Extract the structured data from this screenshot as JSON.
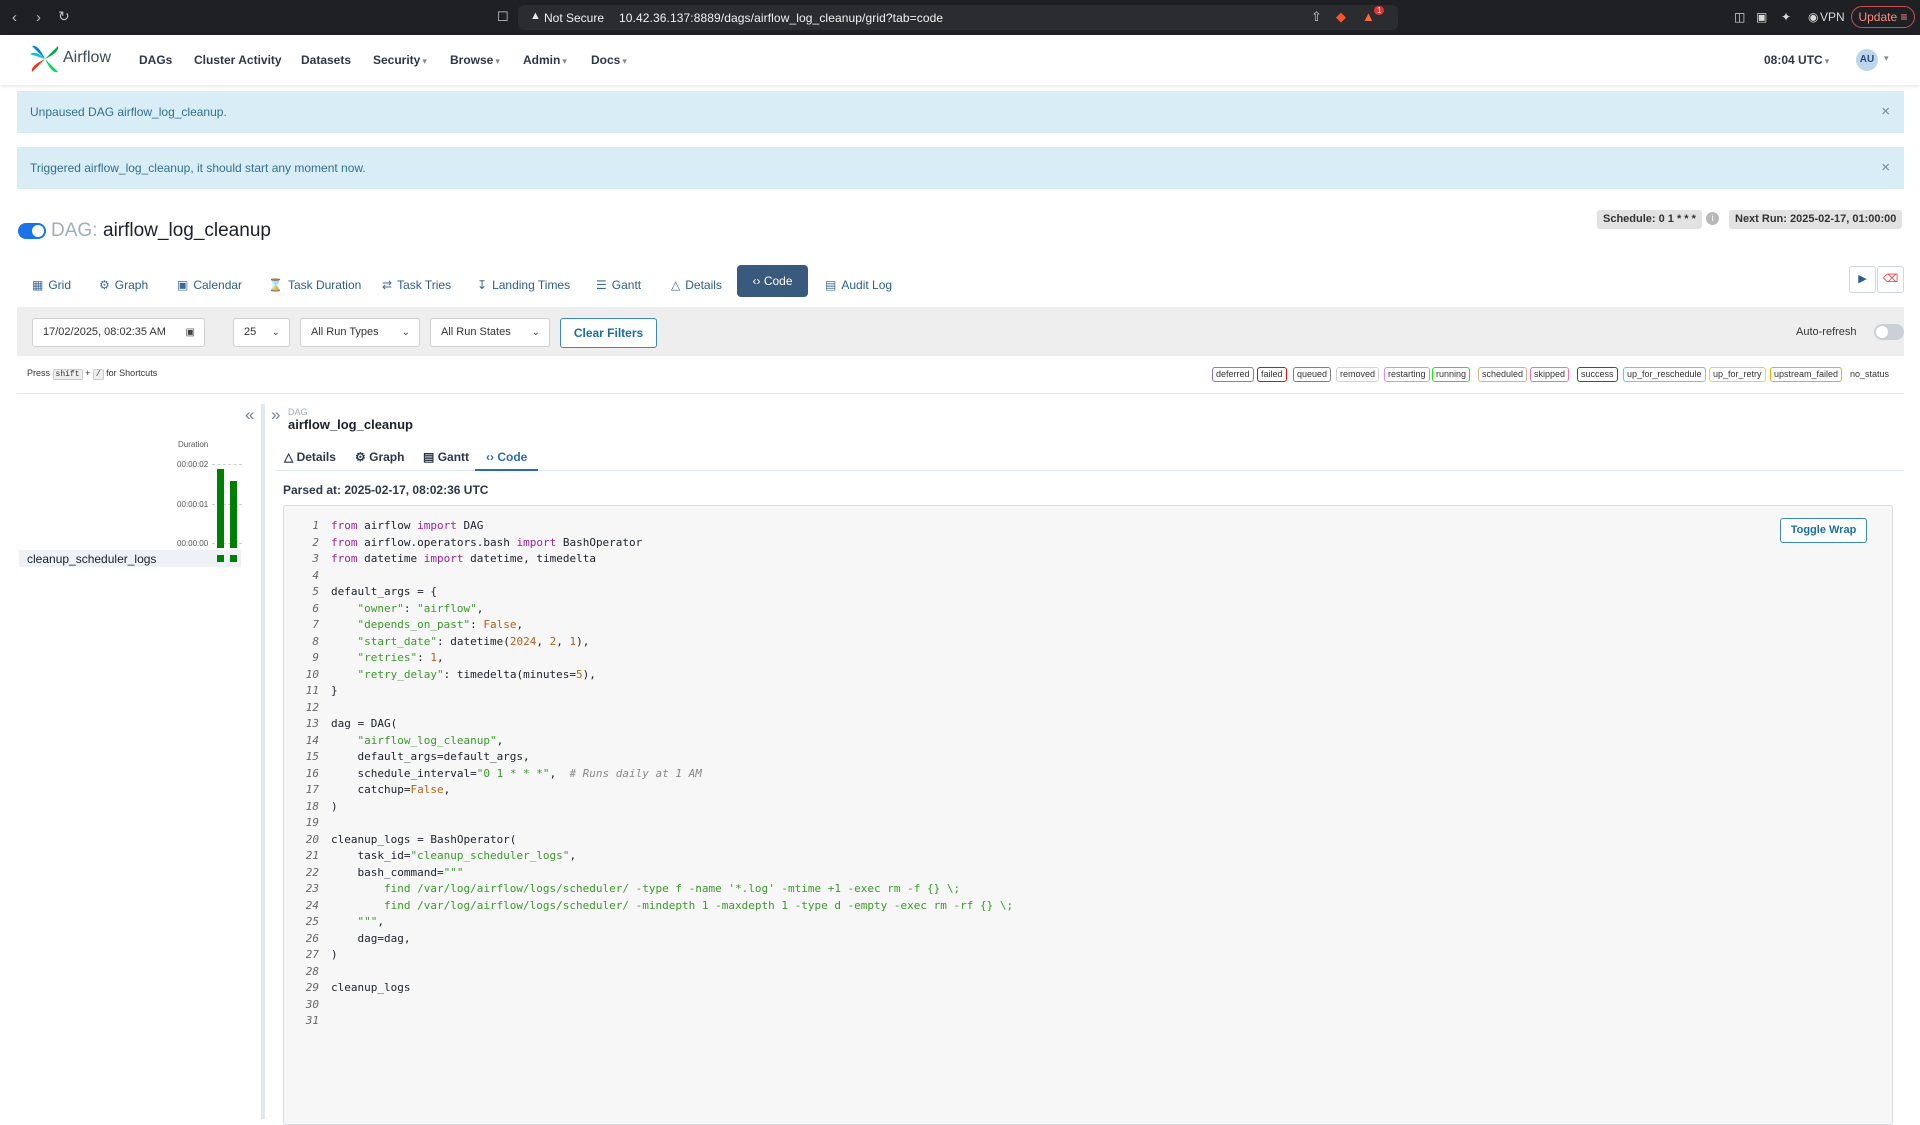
{
  "browser": {
    "security_label": "Not Secure",
    "url": "10.42.36.137:8889/dags/airflow_log_cleanup/grid?tab=code",
    "vpn_label": "VPN",
    "update_label": "Update",
    "brave_badge": "1"
  },
  "header": {
    "brand": "Airflow",
    "nav": [
      {
        "label": "DAGs"
      },
      {
        "label": "Cluster Activity"
      },
      {
        "label": "Datasets"
      },
      {
        "label": "Security"
      },
      {
        "label": "Browse"
      },
      {
        "label": "Admin"
      },
      {
        "label": "Docs"
      }
    ],
    "clock": "08:04 UTC",
    "avatar": "AU"
  },
  "alerts": [
    "Unpaused DAG airflow_log_cleanup.",
    "Triggered airflow_log_cleanup, it should start any moment now."
  ],
  "dag": {
    "prefix": "DAG:",
    "title": "airflow_log_cleanup",
    "schedule": "Schedule: 0 1 * * *",
    "next_run": "Next Run: 2025-02-17, 01:00:00"
  },
  "tabs": [
    "Grid",
    "Graph",
    "Calendar",
    "Task Duration",
    "Task Tries",
    "Landing Times",
    "Gantt",
    "Details",
    "Code",
    "Audit Log"
  ],
  "filters": {
    "date": "17/02/2025, 08:02:35 AM",
    "num_runs": "25",
    "run_types": "All Run Types",
    "run_states": "All Run States",
    "clear_label": "Clear Filters",
    "autorefresh_label": "Auto-refresh",
    "autorefresh_on": false
  },
  "shortcuts": {
    "press": "Press",
    "key1": "shift",
    "plus": "+",
    "key2": "/",
    "suffix": "for Shortcuts"
  },
  "legend": [
    {
      "label": "deferred",
      "color": "#9370db"
    },
    {
      "label": "failed",
      "color": "#ff0000"
    },
    {
      "label": "queued",
      "color": "#808080"
    },
    {
      "label": "removed",
      "color": "#d3d3d3"
    },
    {
      "label": "restarting",
      "color": "#ee82ee"
    },
    {
      "label": "running",
      "color": "#00ff00"
    },
    {
      "label": "scheduled",
      "color": "#d2b48c"
    },
    {
      "label": "skipped",
      "color": "#ff69b4"
    },
    {
      "label": "success",
      "color": "#008000"
    },
    {
      "label": "up_for_reschedule",
      "color": "#40e0d0"
    },
    {
      "label": "up_for_retry",
      "color": "#ffd700"
    },
    {
      "label": "upstream_failed",
      "color": "#ffa500"
    }
  ],
  "legend_no_status": "no_status",
  "grid": {
    "duration_label": "Duration",
    "ticks": [
      "00:00:02",
      "00:00:01",
      "00:00:00"
    ],
    "run_durations_seconds": [
      2.0,
      1.7
    ],
    "task_name": "cleanup_scheduler_logs",
    "task_states": [
      "success",
      "success"
    ]
  },
  "details_panel": {
    "dag_small": "DAG",
    "dag_name": "airflow_log_cleanup",
    "subtabs": [
      "Details",
      "Graph",
      "Gantt",
      "Code"
    ],
    "parsed_at": "Parsed at: 2025-02-17, 08:02:36 UTC",
    "toggle_wrap": "Toggle Wrap",
    "code": [
      [
        [
          "kw",
          "from"
        ],
        [
          "t",
          " airflow "
        ],
        [
          "kw",
          "import"
        ],
        [
          "t",
          " DAG"
        ]
      ],
      [
        [
          "kw",
          "from"
        ],
        [
          "t",
          " airflow.operators.bash "
        ],
        [
          "kw",
          "import"
        ],
        [
          "t",
          " BashOperator"
        ]
      ],
      [
        [
          "kw",
          "from"
        ],
        [
          "t",
          " datetime "
        ],
        [
          "kw",
          "import"
        ],
        [
          "t",
          " datetime, timedelta"
        ]
      ],
      [],
      [
        [
          "t",
          "default_args = {"
        ]
      ],
      [
        [
          "t",
          "    "
        ],
        [
          "str",
          "\"owner\""
        ],
        [
          "t",
          ": "
        ],
        [
          "str",
          "\"airflow\""
        ],
        [
          "t",
          ","
        ]
      ],
      [
        [
          "t",
          "    "
        ],
        [
          "str",
          "\"depends_on_past\""
        ],
        [
          "t",
          ": "
        ],
        [
          "num",
          "False"
        ],
        [
          "t",
          ","
        ]
      ],
      [
        [
          "t",
          "    "
        ],
        [
          "str",
          "\"start_date\""
        ],
        [
          "t",
          ": datetime("
        ],
        [
          "num",
          "2024"
        ],
        [
          "t",
          ", "
        ],
        [
          "num",
          "2"
        ],
        [
          "t",
          ", "
        ],
        [
          "num",
          "1"
        ],
        [
          "t",
          "),"
        ]
      ],
      [
        [
          "t",
          "    "
        ],
        [
          "str",
          "\"retries\""
        ],
        [
          "t",
          ": "
        ],
        [
          "num",
          "1"
        ],
        [
          "t",
          ","
        ]
      ],
      [
        [
          "t",
          "    "
        ],
        [
          "str",
          "\"retry_delay\""
        ],
        [
          "t",
          ": timedelta(minutes="
        ],
        [
          "num",
          "5"
        ],
        [
          "t",
          "),"
        ]
      ],
      [
        [
          "t",
          "}"
        ]
      ],
      [],
      [
        [
          "t",
          "dag = DAG("
        ]
      ],
      [
        [
          "t",
          "    "
        ],
        [
          "str",
          "\"airflow_log_cleanup\""
        ],
        [
          "t",
          ","
        ]
      ],
      [
        [
          "t",
          "    default_args=default_args,"
        ]
      ],
      [
        [
          "t",
          "    schedule_interval="
        ],
        [
          "str",
          "\"0 1 * * *\""
        ],
        [
          "t",
          ",  "
        ],
        [
          "com",
          "# Runs daily at 1 AM"
        ]
      ],
      [
        [
          "t",
          "    catchup="
        ],
        [
          "num",
          "False"
        ],
        [
          "t",
          ","
        ]
      ],
      [
        [
          "t",
          ")"
        ]
      ],
      [],
      [
        [
          "t",
          "cleanup_logs = BashOperator("
        ]
      ],
      [
        [
          "t",
          "    task_id="
        ],
        [
          "str",
          "\"cleanup_scheduler_logs\""
        ],
        [
          "t",
          ","
        ]
      ],
      [
        [
          "t",
          "    bash_command="
        ],
        [
          "str",
          "\"\"\""
        ]
      ],
      [
        [
          "str",
          "        find /var/log/airflow/logs/scheduler/ -type f -name '*.log' -mtime +1 -exec rm -f {} \\;"
        ]
      ],
      [
        [
          "str",
          "        find /var/log/airflow/logs/scheduler/ -mindepth 1 -maxdepth 1 -type d -empty -exec rm -rf {} \\;"
        ]
      ],
      [
        [
          "str",
          "    \"\"\""
        ],
        [
          "t",
          ","
        ]
      ],
      [
        [
          "t",
          "    dag=dag,"
        ]
      ],
      [
        [
          "t",
          ")"
        ]
      ],
      [],
      [
        [
          "t",
          "cleanup_logs"
        ]
      ],
      [],
      []
    ]
  }
}
